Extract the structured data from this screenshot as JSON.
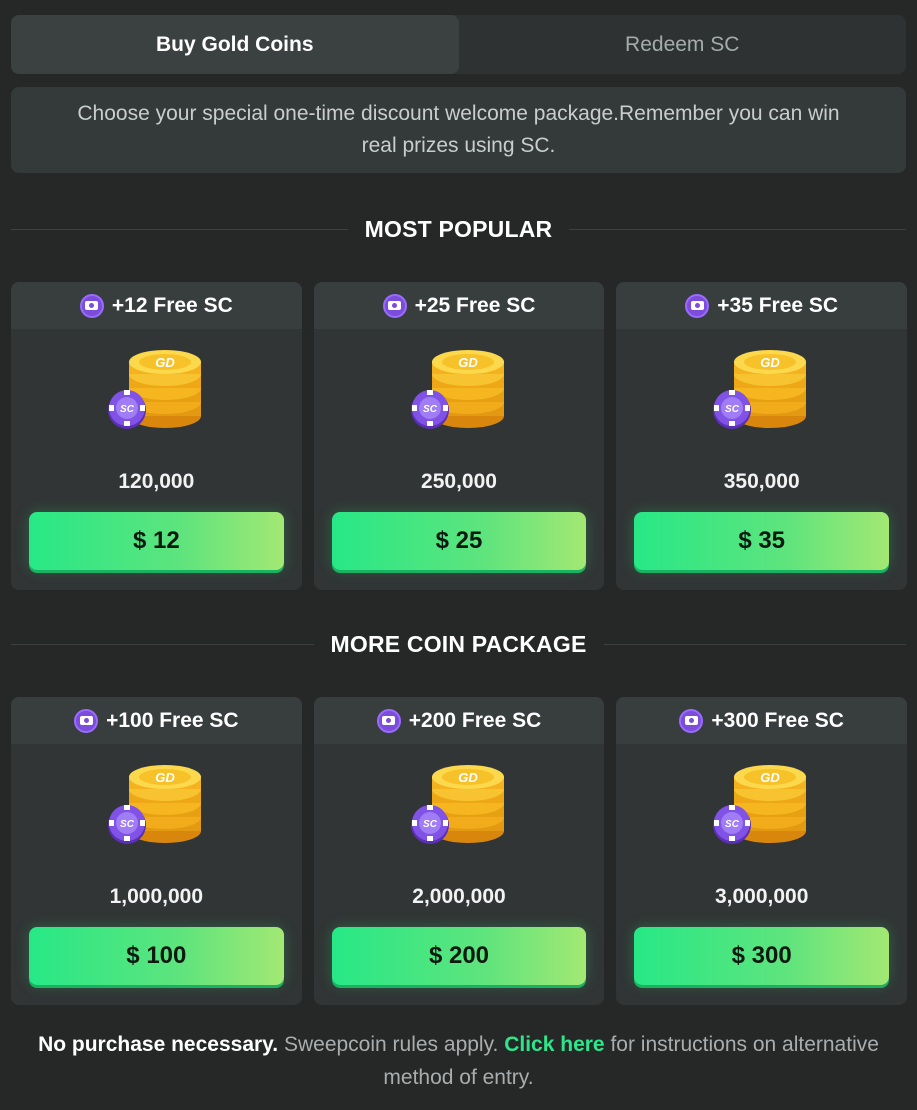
{
  "tabs": [
    {
      "label": "Buy Gold Coins",
      "active": true
    },
    {
      "label": "Redeem SC",
      "active": false
    }
  ],
  "notice": "Choose your special one-time discount welcome package.Remember you can win real prizes using SC.",
  "sections": [
    {
      "title": "MOST POPULAR",
      "packages": [
        {
          "bonus": "+12 Free SC",
          "coins": "120,000",
          "price": "$ 12"
        },
        {
          "bonus": "+25 Free SC",
          "coins": "250,000",
          "price": "$ 25"
        },
        {
          "bonus": "+35 Free SC",
          "coins": "350,000",
          "price": "$ 35"
        }
      ]
    },
    {
      "title": "MORE COIN PACKAGE",
      "packages": [
        {
          "bonus": "+100 Free SC",
          "coins": "1,000,000",
          "price": "$ 100"
        },
        {
          "bonus": "+200 Free SC",
          "coins": "2,000,000",
          "price": "$ 200"
        },
        {
          "bonus": "+300 Free SC",
          "coins": "3,000,000",
          "price": "$ 300"
        }
      ]
    }
  ],
  "coin_labels": {
    "gold": "GD",
    "sweep": "SC"
  },
  "footer": {
    "bold": "No purchase necessary.",
    "text1": " Sweepcoin rules apply. ",
    "link": "Click here",
    "text2": " for instructions on alternative method of entry."
  },
  "colors": {
    "accent_green": "#2ee68a",
    "sc_purple": "#7c4ddb",
    "gold": "#f5b21a"
  }
}
